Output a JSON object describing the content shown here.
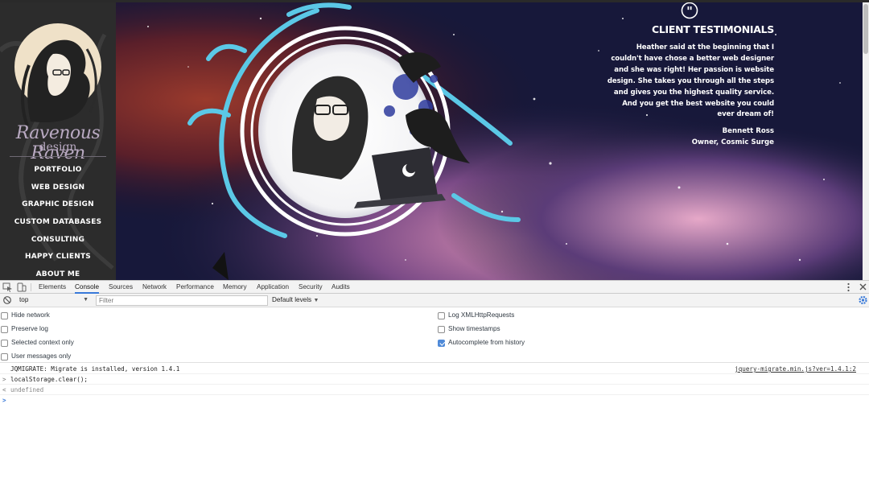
{
  "site": {
    "brand": {
      "name": "Ravenous Raven",
      "sub": "design"
    },
    "nav": [
      "PORTFOLIO",
      "WEB DESIGN",
      "GRAPHIC DESIGN",
      "CUSTOM DATABASES",
      "CONSULTING",
      "HAPPY CLIENTS",
      "ABOUT ME"
    ],
    "testimonial": {
      "icon": "quote-icon",
      "heading": "CLIENT TESTIMONIALS",
      "body": "Heather said at the beginning that I couldn't have chose a better web designer and she was right! Her passion is website design. She takes you through all the steps and gives you the highest quality service. And you get the best website you could ever dream of!",
      "name": "Bennett Ross",
      "role": "Owner, Cosmic Surge"
    },
    "colors": {
      "sidebar": "#2c2c2c",
      "accent": "#5bc8e6",
      "space": "#1a1b3a"
    }
  },
  "devtools": {
    "tabs": [
      "Elements",
      "Console",
      "Sources",
      "Network",
      "Performance",
      "Memory",
      "Application",
      "Security",
      "Audits"
    ],
    "active_tab": "Console",
    "toolbar": {
      "context": "top",
      "filter_placeholder": "Filter",
      "levels": "Default levels"
    },
    "options_left": [
      {
        "label": "Hide network",
        "checked": false
      },
      {
        "label": "Preserve log",
        "checked": false
      },
      {
        "label": "Selected context only",
        "checked": false
      },
      {
        "label": "User messages only",
        "checked": false
      }
    ],
    "options_right": [
      {
        "label": "Log XMLHttpRequests",
        "checked": false
      },
      {
        "label": "Show timestamps",
        "checked": false
      },
      {
        "label": "Autocomplete from history",
        "checked": true
      }
    ],
    "console_lines": [
      {
        "gutter": "",
        "text": "JQMIGRATE: Migrate is installed, version 1.4.1",
        "source": "jquery-migrate.min.js?ver=1.4.1:2"
      },
      {
        "gutter": ">",
        "text": "localStorage.clear();",
        "source": ""
      },
      {
        "gutter": "<",
        "text": "undefined",
        "source": ""
      },
      {
        "gutter": ">",
        "text": "",
        "source": ""
      }
    ]
  }
}
